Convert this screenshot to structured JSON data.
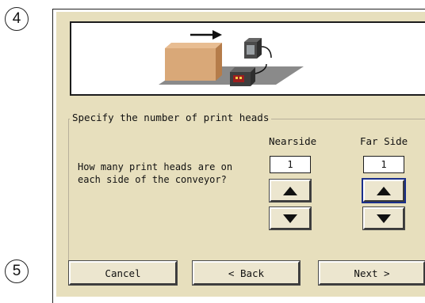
{
  "callouts": {
    "top": "4",
    "bottom": "5"
  },
  "dialog": {
    "illustration": "conveyor-print-heads-illustration",
    "group_label": "Specify the number of print heads",
    "question": "How many print heads are on\neach side of the conveyor?",
    "nearside": {
      "label": "Nearside",
      "value": "1"
    },
    "farside": {
      "label": "Far Side",
      "value": "1"
    },
    "buttons": {
      "cancel": "Cancel",
      "back": "< Back",
      "next": "Next >"
    }
  },
  "colors": {
    "dialog_bg": "#e7dfbd",
    "focus": "#1b2f8a",
    "box": "#d9a878",
    "platform": "#8a8a8a"
  }
}
